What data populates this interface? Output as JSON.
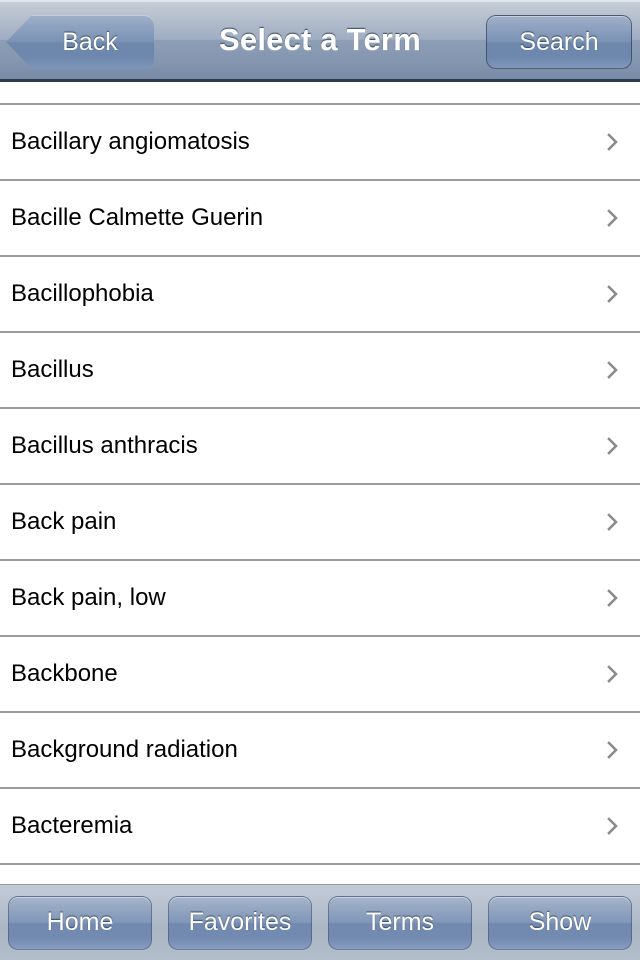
{
  "navbar": {
    "title": "Select a Term",
    "back_label": "Back",
    "search_label": "Search",
    "back_icon": "chevron-left-icon",
    "gradient_top": "#c7ced9",
    "gradient_bottom": "#778aa6",
    "border_color": "#2f3b4d",
    "title_color": "#ffffff"
  },
  "list": {
    "separator_color": "#9a9a9a",
    "background": "#ffffff",
    "text_color": "#000000",
    "disclosure_icon": "chevron-right-icon",
    "disclosure_color": "#8c8c8c",
    "items": [
      {
        "label": "Bacillary angiomatosis"
      },
      {
        "label": "Bacille Calmette Guerin"
      },
      {
        "label": "Bacillophobia"
      },
      {
        "label": "Bacillus"
      },
      {
        "label": "Bacillus anthracis"
      },
      {
        "label": "Back pain"
      },
      {
        "label": "Back pain, low"
      },
      {
        "label": "Backbone"
      },
      {
        "label": "Background radiation"
      },
      {
        "label": "Bacteremia"
      }
    ]
  },
  "toolbar": {
    "background": "#b4bfcd",
    "button_color": "#7f96b8",
    "buttons": [
      {
        "label": "Home",
        "name": "home"
      },
      {
        "label": "Favorites",
        "name": "favorites"
      },
      {
        "label": "Terms",
        "name": "terms"
      },
      {
        "label": "Show",
        "name": "show"
      }
    ]
  }
}
